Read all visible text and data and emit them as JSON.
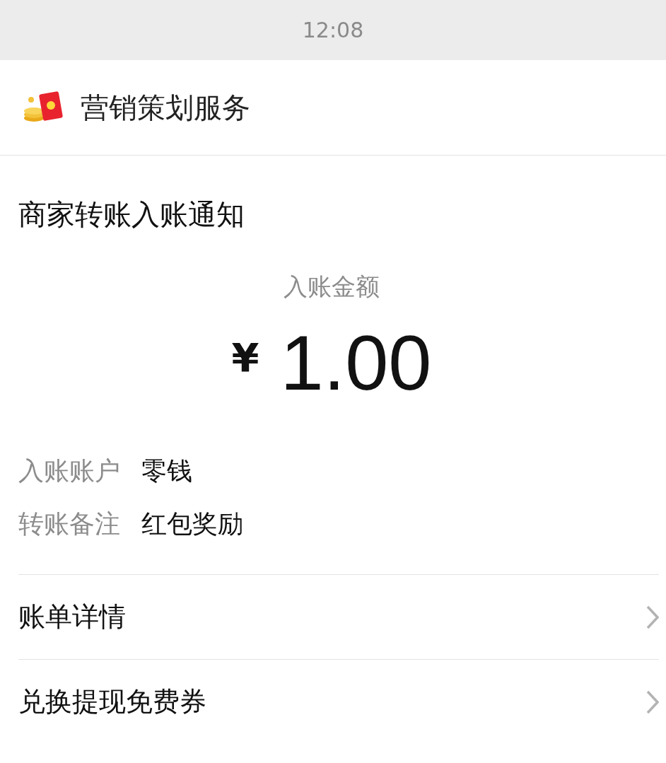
{
  "status_bar": {
    "time": "12:08"
  },
  "header": {
    "title": "营销策划服务"
  },
  "notice": {
    "title": "商家转账入账通知",
    "amount_label": "入账金额",
    "currency": "¥",
    "amount": "1.00",
    "details": [
      {
        "label": "入账账户",
        "value": "零钱"
      },
      {
        "label": "转账备注",
        "value": "红包奖励"
      }
    ]
  },
  "links": [
    {
      "label": "账单详情"
    },
    {
      "label": "兑换提现免费券"
    }
  ]
}
